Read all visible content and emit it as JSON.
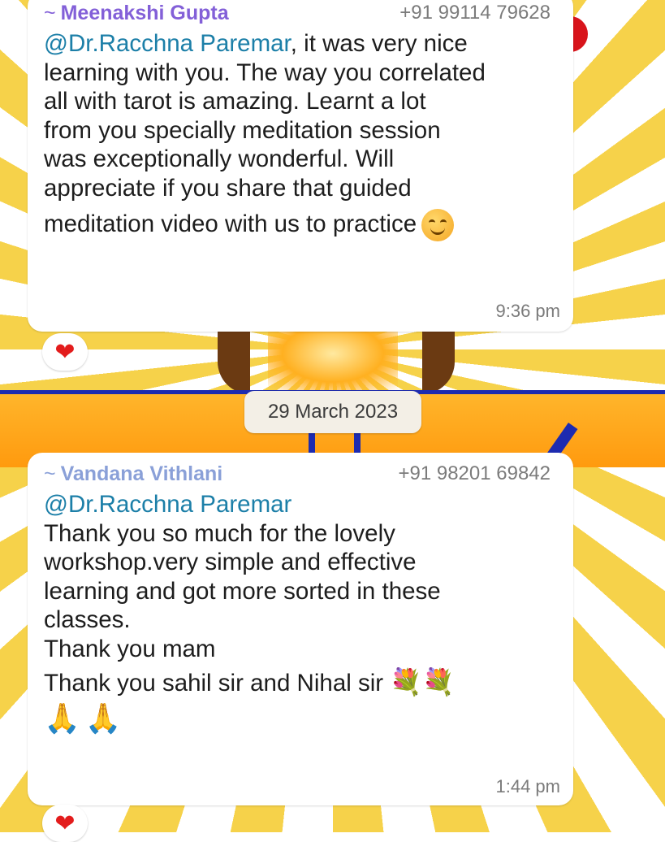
{
  "messages": [
    {
      "sender": "Meenakshi Gupta",
      "sender_prefix": "~",
      "phone": "+91 99114 79628",
      "mention": "@Dr.Racchna Paremar",
      "first_line_rest": ", it was very nice",
      "lines": [
        "learning with you. The way you correlated",
        "all with tarot is amazing. Learnt a lot",
        "from you specially meditation session",
        "was exceptionally wonderful. Will",
        "appreciate if you share that guided",
        "meditation video with us to practice"
      ],
      "emoji": "smiling-face",
      "time": "9:36 pm",
      "reaction": "❤"
    },
    {
      "sender": "Vandana Vithlani",
      "sender_prefix": "~",
      "phone": "+91 98201 69842",
      "mention": "@Dr.Racchna Paremar",
      "lines": [
        "Thank you so much for the lovely",
        "workshop.very simple and effective",
        "learning and got more sorted in these",
        "classes.",
        "Thank you mam",
        "Thank you sahil sir and Nihal sir"
      ],
      "flowers": "💐💐",
      "folded_hands": "🙏🙏",
      "time": "1:44 pm",
      "reaction": "❤"
    }
  ],
  "date_separator": "29 March 2023",
  "colors": {
    "sender1": "#8360d8",
    "sender2": "#8aa0d8",
    "mention": "#1c7fa8",
    "reaction": "#e31c1c"
  }
}
